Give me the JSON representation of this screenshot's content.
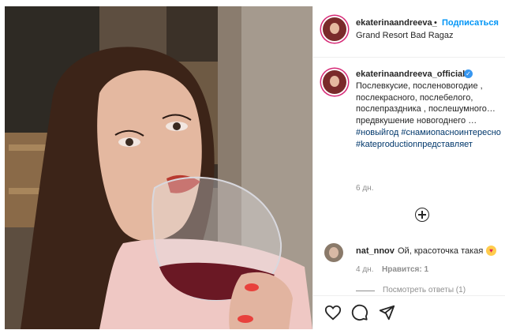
{
  "header": {
    "username": "ekaterinaandreeva_",
    "separator": "•",
    "follow_label": "Подписаться",
    "location": "Grand Resort Bad Ragaz",
    "more_icon": "more-horizontal-icon"
  },
  "caption": {
    "username": "ekaterinaandreeva_official",
    "verified": true,
    "text": "Послевкусие, посленовогодие , послекрасного, послебелого, послепраздника , послешумного… предвкушение новогоднего …",
    "hashtags": [
      "#новыйгод",
      "#снамиопасноинтересно",
      "#kateproductionпредставляет"
    ],
    "age": "6 дн."
  },
  "load_more_icon": "plus-circle-icon",
  "comments": [
    {
      "username": "nat_nnov",
      "text": "Ой, красоточка такая",
      "emoji": "heart-eyes",
      "age": "4 дн.",
      "likes": "Нравится: 1",
      "replies": "Посмотреть ответы (1)"
    }
  ],
  "actions": [
    "heart-icon",
    "comment-icon",
    "share-icon"
  ],
  "colors": {
    "accent": "#0095f6",
    "muted": "#8e8e8e",
    "text": "#262626",
    "hashtag": "#00376b",
    "story_ring": "#d62976"
  }
}
